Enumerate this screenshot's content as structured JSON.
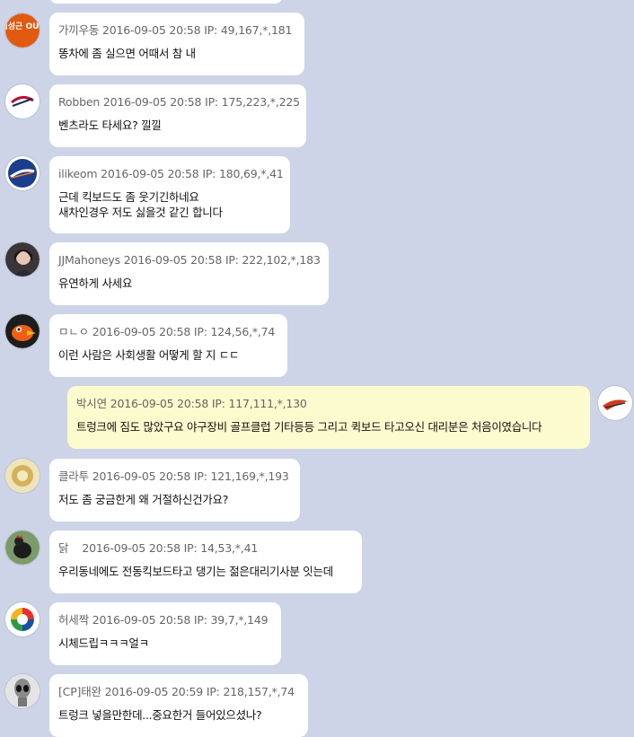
{
  "comments": [
    {
      "nickname": "가끼우동",
      "timestamp": "2016-09-05 20:58",
      "ip": "IP: 49,167,*,181",
      "text": "똥차에 좀 실으면 어때서 참 내",
      "avatar": "kim-sung-geun-out-avatar",
      "avatar_text": "김성근 OUT"
    },
    {
      "nickname": "Robben",
      "timestamp": "2016-09-05 20:58",
      "ip": "IP: 175,223,*,225",
      "text": "벤츠라도 타세요? 낄낄",
      "avatar": "braves-logo-avatar"
    },
    {
      "nickname": "ilikeom",
      "timestamp": "2016-09-05 20:58",
      "ip": "IP: 180,69,*,41",
      "text": "근데 킥보드도 좀 웃기긴하네요\n새차인경우 저도 싫을것 같긴 합니다",
      "avatar": "mets-logo-avatar"
    },
    {
      "nickname": "JJMahoneys",
      "timestamp": "2016-09-05 20:58",
      "ip": "IP: 222,102,*,183",
      "text": "유연하게 사세요",
      "avatar": "person-photo-avatar"
    },
    {
      "nickname": "ㅁㄴㅇ",
      "timestamp": "2016-09-05 20:58",
      "ip": "IP: 124,56,*,74",
      "text": "이런 사람은 사회생활 어떻게 할 지 ㄷㄷ",
      "avatar": "orioles-bird-avatar"
    },
    {
      "nickname": "박시연",
      "timestamp": "2016-09-05 20:58",
      "ip": "IP: 117,111,*,130",
      "text": "트렁크에 짐도 많았구요 야구장비 골프클럽 기타등등 그리고 퀵보드 타고오신 대리분은 처음이였습니다",
      "avatar": "eagles-logo-avatar",
      "side": "right"
    },
    {
      "nickname": "클라투",
      "timestamp": "2016-09-05 20:58",
      "ip": "IP: 121,169,*,193",
      "text": "저도 좀 궁금한게 왜 거절하신건가요?",
      "avatar": "gold-emblem-avatar"
    },
    {
      "nickname": "닭",
      "timestamp": "2016-09-05 20:58",
      "ip": "IP: 14,53,*,41",
      "text": "우리동네에도 전동킥보드타고 댕기는 젊은대리기사분 잇는데",
      "avatar": "rooster-avatar"
    },
    {
      "nickname": "허세짝",
      "timestamp": "2016-09-05 20:58",
      "ip": "IP: 39,7,*,149",
      "text": "시체드립ㅋㅋㅋ얼ㅋ",
      "avatar": "wbc-logo-avatar"
    },
    {
      "nickname": "[CP]태완",
      "timestamp": "2016-09-05 20:59",
      "ip": "IP: 218,157,*,74",
      "text": "트렁크 넣을만한데...중요한거 들어있으셨나?",
      "avatar": "alien-avatar"
    }
  ],
  "colors": {
    "background": "#cdd4e7",
    "bubble": "#ffffff",
    "own_bubble": "#fbfbce",
    "meta_text": "#666666"
  }
}
